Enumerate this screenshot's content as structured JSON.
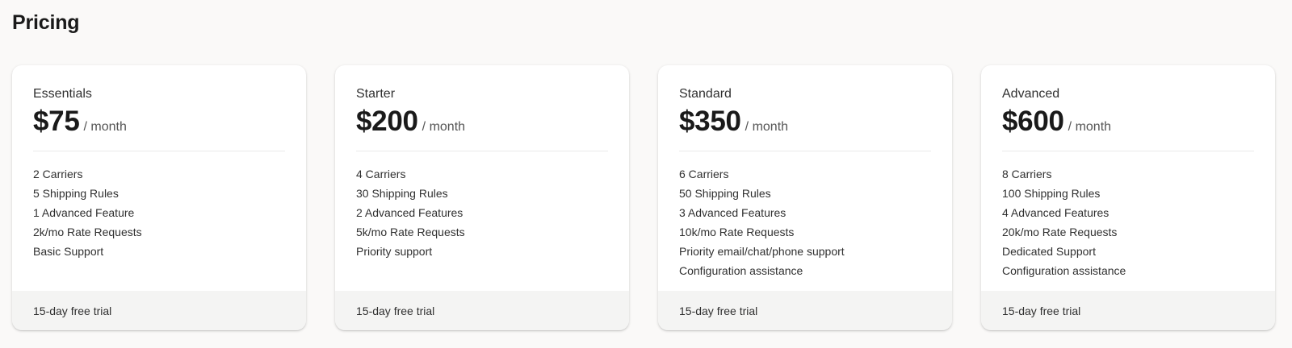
{
  "page": {
    "title": "Pricing"
  },
  "plans": [
    {
      "name": "Essentials",
      "price": "$75",
      "period": "/ month",
      "features": [
        "2 Carriers",
        "5 Shipping Rules",
        "1 Advanced Feature",
        "2k/mo Rate Requests",
        "Basic Support"
      ],
      "footer": "15-day free trial"
    },
    {
      "name": "Starter",
      "price": "$200",
      "period": "/ month",
      "features": [
        "4 Carriers",
        "30 Shipping Rules",
        "2 Advanced Features",
        "5k/mo Rate Requests",
        "Priority support"
      ],
      "footer": "15-day free trial"
    },
    {
      "name": "Standard",
      "price": "$350",
      "period": "/ month",
      "features": [
        "6 Carriers",
        "50 Shipping Rules",
        "3 Advanced Features",
        "10k/mo Rate Requests",
        "Priority email/chat/phone support",
        "Configuration assistance"
      ],
      "footer": "15-day free trial"
    },
    {
      "name": "Advanced",
      "price": "$600",
      "period": "/ month",
      "features": [
        "8 Carriers",
        "100 Shipping Rules",
        "4 Advanced Features",
        "20k/mo Rate Requests",
        "Dedicated Support",
        "Configuration assistance"
      ],
      "footer": "15-day free trial"
    }
  ]
}
